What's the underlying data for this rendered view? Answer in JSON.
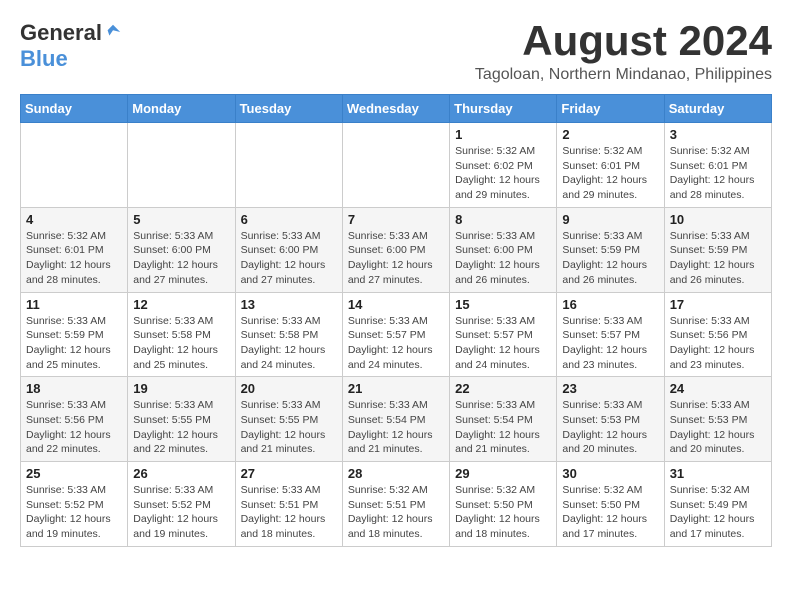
{
  "header": {
    "logo": {
      "text_general": "General",
      "text_blue": "Blue"
    },
    "month_year": "August 2024",
    "location": "Tagoloan, Northern Mindanao, Philippines"
  },
  "calendar": {
    "days_of_week": [
      "Sunday",
      "Monday",
      "Tuesday",
      "Wednesday",
      "Thursday",
      "Friday",
      "Saturday"
    ],
    "weeks": [
      {
        "days": [
          {
            "date": "",
            "info": ""
          },
          {
            "date": "",
            "info": ""
          },
          {
            "date": "",
            "info": ""
          },
          {
            "date": "",
            "info": ""
          },
          {
            "date": "1",
            "info": "Sunrise: 5:32 AM\nSunset: 6:02 PM\nDaylight: 12 hours\nand 29 minutes."
          },
          {
            "date": "2",
            "info": "Sunrise: 5:32 AM\nSunset: 6:01 PM\nDaylight: 12 hours\nand 29 minutes."
          },
          {
            "date": "3",
            "info": "Sunrise: 5:32 AM\nSunset: 6:01 PM\nDaylight: 12 hours\nand 28 minutes."
          }
        ]
      },
      {
        "days": [
          {
            "date": "4",
            "info": "Sunrise: 5:32 AM\nSunset: 6:01 PM\nDaylight: 12 hours\nand 28 minutes."
          },
          {
            "date": "5",
            "info": "Sunrise: 5:33 AM\nSunset: 6:00 PM\nDaylight: 12 hours\nand 27 minutes."
          },
          {
            "date": "6",
            "info": "Sunrise: 5:33 AM\nSunset: 6:00 PM\nDaylight: 12 hours\nand 27 minutes."
          },
          {
            "date": "7",
            "info": "Sunrise: 5:33 AM\nSunset: 6:00 PM\nDaylight: 12 hours\nand 27 minutes."
          },
          {
            "date": "8",
            "info": "Sunrise: 5:33 AM\nSunset: 6:00 PM\nDaylight: 12 hours\nand 26 minutes."
          },
          {
            "date": "9",
            "info": "Sunrise: 5:33 AM\nSunset: 5:59 PM\nDaylight: 12 hours\nand 26 minutes."
          },
          {
            "date": "10",
            "info": "Sunrise: 5:33 AM\nSunset: 5:59 PM\nDaylight: 12 hours\nand 26 minutes."
          }
        ]
      },
      {
        "days": [
          {
            "date": "11",
            "info": "Sunrise: 5:33 AM\nSunset: 5:59 PM\nDaylight: 12 hours\nand 25 minutes."
          },
          {
            "date": "12",
            "info": "Sunrise: 5:33 AM\nSunset: 5:58 PM\nDaylight: 12 hours\nand 25 minutes."
          },
          {
            "date": "13",
            "info": "Sunrise: 5:33 AM\nSunset: 5:58 PM\nDaylight: 12 hours\nand 24 minutes."
          },
          {
            "date": "14",
            "info": "Sunrise: 5:33 AM\nSunset: 5:57 PM\nDaylight: 12 hours\nand 24 minutes."
          },
          {
            "date": "15",
            "info": "Sunrise: 5:33 AM\nSunset: 5:57 PM\nDaylight: 12 hours\nand 24 minutes."
          },
          {
            "date": "16",
            "info": "Sunrise: 5:33 AM\nSunset: 5:57 PM\nDaylight: 12 hours\nand 23 minutes."
          },
          {
            "date": "17",
            "info": "Sunrise: 5:33 AM\nSunset: 5:56 PM\nDaylight: 12 hours\nand 23 minutes."
          }
        ]
      },
      {
        "days": [
          {
            "date": "18",
            "info": "Sunrise: 5:33 AM\nSunset: 5:56 PM\nDaylight: 12 hours\nand 22 minutes."
          },
          {
            "date": "19",
            "info": "Sunrise: 5:33 AM\nSunset: 5:55 PM\nDaylight: 12 hours\nand 22 minutes."
          },
          {
            "date": "20",
            "info": "Sunrise: 5:33 AM\nSunset: 5:55 PM\nDaylight: 12 hours\nand 21 minutes."
          },
          {
            "date": "21",
            "info": "Sunrise: 5:33 AM\nSunset: 5:54 PM\nDaylight: 12 hours\nand 21 minutes."
          },
          {
            "date": "22",
            "info": "Sunrise: 5:33 AM\nSunset: 5:54 PM\nDaylight: 12 hours\nand 21 minutes."
          },
          {
            "date": "23",
            "info": "Sunrise: 5:33 AM\nSunset: 5:53 PM\nDaylight: 12 hours\nand 20 minutes."
          },
          {
            "date": "24",
            "info": "Sunrise: 5:33 AM\nSunset: 5:53 PM\nDaylight: 12 hours\nand 20 minutes."
          }
        ]
      },
      {
        "days": [
          {
            "date": "25",
            "info": "Sunrise: 5:33 AM\nSunset: 5:52 PM\nDaylight: 12 hours\nand 19 minutes."
          },
          {
            "date": "26",
            "info": "Sunrise: 5:33 AM\nSunset: 5:52 PM\nDaylight: 12 hours\nand 19 minutes."
          },
          {
            "date": "27",
            "info": "Sunrise: 5:33 AM\nSunset: 5:51 PM\nDaylight: 12 hours\nand 18 minutes."
          },
          {
            "date": "28",
            "info": "Sunrise: 5:32 AM\nSunset: 5:51 PM\nDaylight: 12 hours\nand 18 minutes."
          },
          {
            "date": "29",
            "info": "Sunrise: 5:32 AM\nSunset: 5:50 PM\nDaylight: 12 hours\nand 18 minutes."
          },
          {
            "date": "30",
            "info": "Sunrise: 5:32 AM\nSunset: 5:50 PM\nDaylight: 12 hours\nand 17 minutes."
          },
          {
            "date": "31",
            "info": "Sunrise: 5:32 AM\nSunset: 5:49 PM\nDaylight: 12 hours\nand 17 minutes."
          }
        ]
      }
    ]
  }
}
